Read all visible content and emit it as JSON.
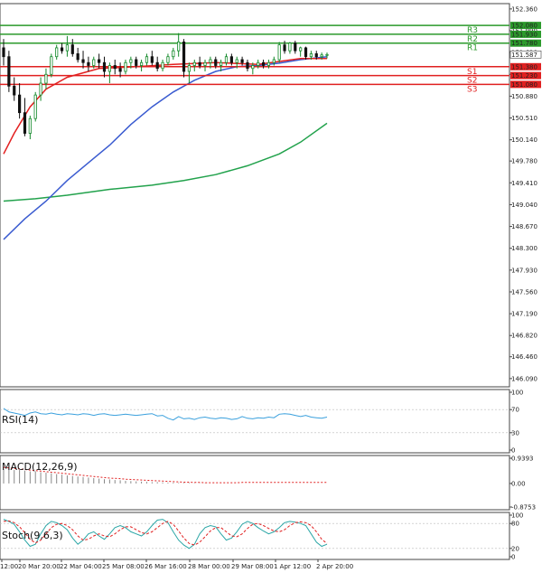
{
  "colors": {
    "bg": "#ffffff",
    "grid": "#d0d0d0",
    "border": "#444444",
    "bull": "#138a2a",
    "bear": "#111111",
    "ma_fast": "#e31f1f",
    "ma_mid": "#3a5bd0",
    "ma_slow": "#22a24c",
    "resistance": "#2b9a2b",
    "support": "#e02020",
    "rsi": "#3aa0dd",
    "macd_hist": "#888888",
    "macd_signal": "#e02020",
    "stoch_main": "#2aa6a6",
    "stoch_signal": "#e02020"
  },
  "chart_data": [
    {
      "type": "candlestick",
      "ylim": [
        145.95,
        152.45
      ],
      "y_ticks": [
        152.36,
        151.99,
        151.62,
        151.25,
        150.88,
        150.51,
        150.14,
        149.78,
        149.41,
        149.04,
        148.67,
        148.3,
        147.93,
        147.56,
        147.19,
        146.82,
        146.46,
        146.09
      ],
      "y_tick_labels": [
        "152.360",
        "151.990",
        "151.620",
        "151.250",
        "150.880",
        "150.510",
        "150.140",
        "149.780",
        "149.410",
        "149.040",
        "148.670",
        "148.300",
        "147.930",
        "147.560",
        "147.190",
        "146.820",
        "146.460",
        "146.090"
      ],
      "levels": [
        {
          "name": "R3",
          "value": 152.08,
          "label": "152.080",
          "kind": "resistance"
        },
        {
          "name": "R2",
          "value": 151.93,
          "label": "151.930",
          "kind": "resistance"
        },
        {
          "name": "R1",
          "value": 151.78,
          "label": "151.780",
          "kind": "resistance"
        },
        {
          "name": "S1",
          "value": 151.38,
          "label": "151.380",
          "kind": "support"
        },
        {
          "name": "S2",
          "value": 151.23,
          "label": "151.230",
          "kind": "support"
        },
        {
          "name": "S3",
          "value": 151.08,
          "label": "151.080",
          "kind": "support"
        }
      ],
      "current_price": {
        "value": 151.587,
        "label": "151.587"
      },
      "x_labels": [
        "12:00",
        "20 Mar 20:00",
        "22 Mar 04:00",
        "25 Mar 08:00",
        "26 Mar 16:00",
        "28 Mar 00:00",
        "29 Mar 08:00",
        "1 Apr 12:00",
        "2 Apr 20:00"
      ],
      "candles": [
        [
          151.7,
          151.85,
          151.4,
          151.55
        ],
        [
          151.55,
          151.65,
          150.95,
          151.05
        ],
        [
          151.05,
          151.2,
          150.8,
          150.9
        ],
        [
          150.9,
          151.1,
          150.5,
          150.6
        ],
        [
          150.6,
          150.85,
          150.2,
          150.25
        ],
        [
          150.25,
          150.55,
          150.15,
          150.5
        ],
        [
          150.5,
          150.95,
          150.45,
          150.9
        ],
        [
          150.9,
          151.2,
          150.8,
          151.1
        ],
        [
          151.1,
          151.35,
          151.0,
          151.25
        ],
        [
          151.25,
          151.6,
          151.2,
          151.55
        ],
        [
          151.55,
          151.75,
          151.5,
          151.7
        ],
        [
          151.7,
          151.78,
          151.6,
          151.65
        ],
        [
          151.65,
          151.9,
          151.55,
          151.75
        ],
        [
          151.75,
          151.85,
          151.55,
          151.6
        ],
        [
          151.6,
          151.7,
          151.45,
          151.5
        ],
        [
          151.5,
          151.65,
          151.35,
          151.45
        ],
        [
          151.45,
          151.55,
          151.3,
          151.4
        ],
        [
          151.4,
          151.55,
          151.35,
          151.5
        ],
        [
          151.5,
          151.6,
          151.35,
          151.45
        ],
        [
          151.45,
          151.55,
          151.2,
          151.3
        ],
        [
          151.3,
          151.45,
          151.1,
          151.4
        ],
        [
          151.4,
          151.5,
          151.25,
          151.35
        ],
        [
          151.35,
          151.45,
          151.2,
          151.3
        ],
        [
          151.3,
          151.5,
          151.25,
          151.45
        ],
        [
          151.45,
          151.55,
          151.35,
          151.5
        ],
        [
          151.5,
          151.55,
          151.35,
          151.4
        ],
        [
          151.4,
          151.5,
          151.3,
          151.45
        ],
        [
          151.45,
          151.6,
          151.4,
          151.55
        ],
        [
          151.55,
          151.65,
          151.4,
          151.45
        ],
        [
          151.45,
          151.55,
          151.3,
          151.35
        ],
        [
          151.35,
          151.5,
          151.3,
          151.45
        ],
        [
          151.45,
          151.6,
          151.4,
          151.55
        ],
        [
          151.55,
          151.7,
          151.5,
          151.65
        ],
        [
          151.65,
          151.95,
          151.55,
          151.8
        ],
        [
          151.8,
          151.85,
          151.2,
          151.3
        ],
        [
          151.3,
          151.45,
          151.1,
          151.4
        ],
        [
          151.4,
          151.5,
          151.3,
          151.45
        ],
        [
          151.45,
          151.55,
          151.35,
          151.4
        ],
        [
          151.4,
          151.5,
          151.3,
          151.45
        ],
        [
          151.45,
          151.55,
          151.35,
          151.5
        ],
        [
          151.5,
          151.55,
          151.35,
          151.4
        ],
        [
          151.4,
          151.5,
          151.3,
          151.45
        ],
        [
          151.45,
          151.6,
          151.4,
          151.55
        ],
        [
          151.55,
          151.6,
          151.4,
          151.45
        ],
        [
          151.45,
          151.55,
          151.35,
          151.5
        ],
        [
          151.5,
          151.55,
          151.4,
          151.45
        ],
        [
          151.45,
          151.5,
          151.3,
          151.35
        ],
        [
          151.35,
          151.45,
          151.25,
          151.4
        ],
        [
          151.4,
          151.5,
          151.35,
          151.45
        ],
        [
          151.45,
          151.5,
          151.35,
          151.4
        ],
        [
          151.4,
          151.5,
          151.35,
          151.45
        ],
        [
          151.45,
          151.55,
          151.4,
          151.5
        ],
        [
          151.5,
          151.8,
          151.45,
          151.75
        ],
        [
          151.75,
          151.82,
          151.6,
          151.65
        ],
        [
          151.65,
          151.8,
          151.6,
          151.78
        ],
        [
          151.78,
          151.82,
          151.6,
          151.65
        ],
        [
          151.65,
          151.72,
          151.55,
          151.7
        ],
        [
          151.7,
          151.72,
          151.5,
          151.55
        ],
        [
          151.55,
          151.65,
          151.5,
          151.6
        ],
        [
          151.6,
          151.65,
          151.5,
          151.55
        ],
        [
          151.55,
          151.62,
          151.5,
          151.58
        ],
        [
          151.58,
          151.62,
          151.52,
          151.587
        ]
      ],
      "ma_fast": [
        [
          0,
          149.9
        ],
        [
          2,
          150.25
        ],
        [
          5,
          150.7
        ],
        [
          8,
          151.0
        ],
        [
          12,
          151.2
        ],
        [
          18,
          151.35
        ],
        [
          25,
          151.38
        ],
        [
          32,
          151.42
        ],
        [
          40,
          151.45
        ],
        [
          48,
          151.42
        ],
        [
          56,
          151.52
        ],
        [
          61,
          151.52
        ]
      ],
      "ma_mid": [
        [
          0,
          148.45
        ],
        [
          4,
          148.8
        ],
        [
          8,
          149.1
        ],
        [
          12,
          149.45
        ],
        [
          16,
          149.75
        ],
        [
          20,
          150.05
        ],
        [
          24,
          150.4
        ],
        [
          28,
          150.7
        ],
        [
          32,
          150.95
        ],
        [
          36,
          151.15
        ],
        [
          40,
          151.3
        ],
        [
          44,
          151.38
        ],
        [
          48,
          151.4
        ],
        [
          52,
          151.44
        ],
        [
          56,
          151.5
        ],
        [
          61,
          151.55
        ]
      ],
      "ma_slow": [
        [
          0,
          149.1
        ],
        [
          6,
          149.14
        ],
        [
          12,
          149.2
        ],
        [
          20,
          149.3
        ],
        [
          28,
          149.37
        ],
        [
          34,
          149.45
        ],
        [
          40,
          149.55
        ],
        [
          46,
          149.7
        ],
        [
          52,
          149.9
        ],
        [
          56,
          150.1
        ],
        [
          61,
          150.42
        ]
      ]
    },
    {
      "type": "line",
      "name": "RSI(14)",
      "y_ticks": [
        100,
        70,
        30,
        0
      ],
      "y_tick_labels": [
        "100",
        "70",
        "30",
        "0"
      ],
      "ylim": [
        0,
        100
      ],
      "values": [
        72,
        66,
        64,
        62,
        60,
        64,
        66,
        63,
        62,
        64,
        62,
        61,
        63,
        62,
        61,
        63,
        62,
        60,
        62,
        63,
        61,
        60,
        61,
        62,
        61,
        60,
        61,
        62,
        63,
        59,
        60,
        55,
        52,
        58,
        54,
        55,
        53,
        56,
        57,
        55,
        54,
        56,
        55,
        53,
        54,
        58,
        55,
        54,
        56,
        55,
        57,
        56,
        62,
        63,
        62,
        60,
        58,
        60,
        57,
        56,
        55,
        57
      ]
    },
    {
      "type": "bar",
      "name": "MACD(12,26,9)",
      "y_ticks": [
        0.9393,
        0.0,
        -0.8753
      ],
      "y_tick_labels": [
        "0.9393",
        "0.00",
        "-0.8753"
      ],
      "ylim": [
        -0.8753,
        0.9393
      ],
      "histogram": [
        0.55,
        0.55,
        0.5,
        0.5,
        0.48,
        0.45,
        0.45,
        0.42,
        0.4,
        0.38,
        0.35,
        0.33,
        0.3,
        0.28,
        0.26,
        0.24,
        0.22,
        0.2,
        0.18,
        0.16,
        0.15,
        0.13,
        0.12,
        0.1,
        0.09,
        0.08,
        0.07,
        0.06,
        0.05,
        0.05,
        0.04,
        0.03,
        0.03,
        0.02,
        0.02,
        0.02,
        0.01,
        0.01,
        0.01,
        0.0,
        0.0,
        0.0,
        0.0,
        0.0,
        0.0,
        0.0,
        0.0,
        0.0,
        0.0,
        0.0,
        0.0,
        0.0,
        0.0,
        0.0,
        0.0,
        0.0,
        0.0,
        0.0,
        0.0,
        0.0,
        0.0,
        0.0
      ],
      "signal": [
        0.6,
        0.58,
        0.56,
        0.54,
        0.52,
        0.5,
        0.48,
        0.46,
        0.44,
        0.42,
        0.4,
        0.38,
        0.36,
        0.34,
        0.32,
        0.3,
        0.28,
        0.26,
        0.24,
        0.22,
        0.2,
        0.19,
        0.18,
        0.16,
        0.15,
        0.14,
        0.13,
        0.12,
        0.11,
        0.1,
        0.09,
        0.08,
        0.07,
        0.06,
        0.05,
        0.05,
        0.04,
        0.04,
        0.03,
        0.03,
        0.03,
        0.03,
        0.03,
        0.03,
        0.03,
        0.04,
        0.04,
        0.04,
        0.04,
        0.04,
        0.04,
        0.04,
        0.04,
        0.04,
        0.04,
        0.04,
        0.04,
        0.04,
        0.04,
        0.04,
        0.04,
        0.04
      ]
    },
    {
      "type": "line",
      "name": "Stoch(9,6,3)",
      "y_ticks": [
        100,
        80,
        20,
        0
      ],
      "y_tick_labels": [
        "100",
        "80",
        "20",
        "0"
      ],
      "ylim": [
        0,
        100
      ],
      "main": [
        90,
        85,
        78,
        60,
        40,
        25,
        30,
        55,
        75,
        85,
        82,
        75,
        65,
        45,
        30,
        40,
        55,
        60,
        50,
        42,
        55,
        70,
        75,
        70,
        60,
        55,
        50,
        60,
        75,
        88,
        90,
        82,
        60,
        40,
        28,
        20,
        30,
        55,
        70,
        75,
        72,
        55,
        40,
        45,
        60,
        78,
        85,
        80,
        70,
        62,
        55,
        60,
        70,
        82,
        85,
        83,
        80,
        75,
        55,
        35,
        25,
        30
      ],
      "signal": [
        85,
        86,
        82,
        72,
        58,
        42,
        33,
        40,
        55,
        70,
        78,
        80,
        75,
        65,
        50,
        40,
        42,
        50,
        55,
        50,
        48,
        55,
        65,
        72,
        72,
        65,
        58,
        55,
        60,
        70,
        80,
        85,
        78,
        62,
        45,
        32,
        28,
        35,
        48,
        62,
        70,
        70,
        60,
        50,
        48,
        55,
        68,
        78,
        80,
        75,
        68,
        62,
        60,
        65,
        75,
        82,
        84,
        82,
        75,
        60,
        42,
        32
      ]
    }
  ],
  "labels": {
    "rsi": "RSI(14)",
    "macd": "MACD(12,26,9)",
    "stoch": "Stoch(9,6,3)"
  }
}
